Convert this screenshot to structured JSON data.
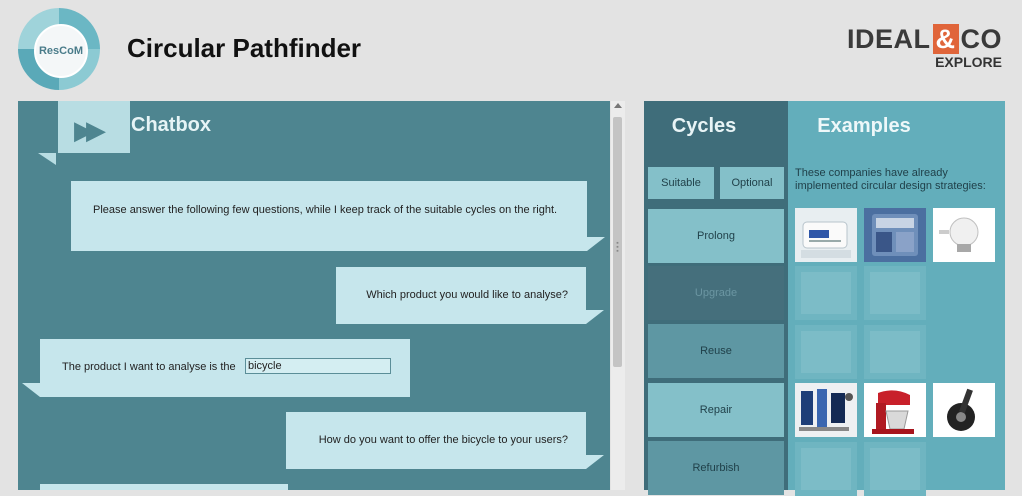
{
  "header": {
    "logo_text": "ResCoM",
    "app_title": "Circular Pathfinder",
    "brand": {
      "ideal": "IDEAL",
      "amp": "&",
      "co": "CO",
      "explore": "EXPLORE"
    }
  },
  "chat": {
    "title": "Chatbox",
    "messages": [
      "Please answer the following few questions, while I keep track of the suitable cycles on the right.",
      "Which product you would like to analyse?",
      "The product I want to analyse is the",
      "How do you want to offer the bicycle to your users?"
    ],
    "answer_value": "bicycle"
  },
  "cycles": {
    "title": "Cycles",
    "filters": [
      "Suitable",
      "Optional"
    ],
    "items": [
      "Prolong",
      "Upgrade",
      "Reuse",
      "Repair",
      "Refurbish"
    ]
  },
  "examples": {
    "title": "Examples",
    "description": "These companies have already implemented circular design strategies:",
    "thumbnails": [
      {
        "icon": "appliance-label-image",
        "active": true
      },
      {
        "icon": "fairphone-image",
        "active": true
      },
      {
        "icon": "light-bulb-image",
        "active": true
      },
      {
        "icon": "printer-image",
        "active": false
      },
      {
        "icon": "device-image",
        "active": false
      },
      {
        "icon": "tool-image",
        "active": false
      },
      {
        "icon": "parts-image",
        "active": false
      },
      {
        "icon": "phone-components-image",
        "active": true
      },
      {
        "icon": "kitchen-mixer-image",
        "active": true
      },
      {
        "icon": "wheel-image",
        "active": true
      },
      {
        "icon": "packaging-image",
        "active": false
      },
      {
        "icon": "product-image",
        "active": false
      }
    ]
  },
  "colors": {
    "chat_bg": "#4e8590",
    "bubble": "#c6e6ec",
    "cycles_bg": "#3f6d7a",
    "examples_bg": "#63aebb",
    "brand_accent": "#e0653a"
  }
}
